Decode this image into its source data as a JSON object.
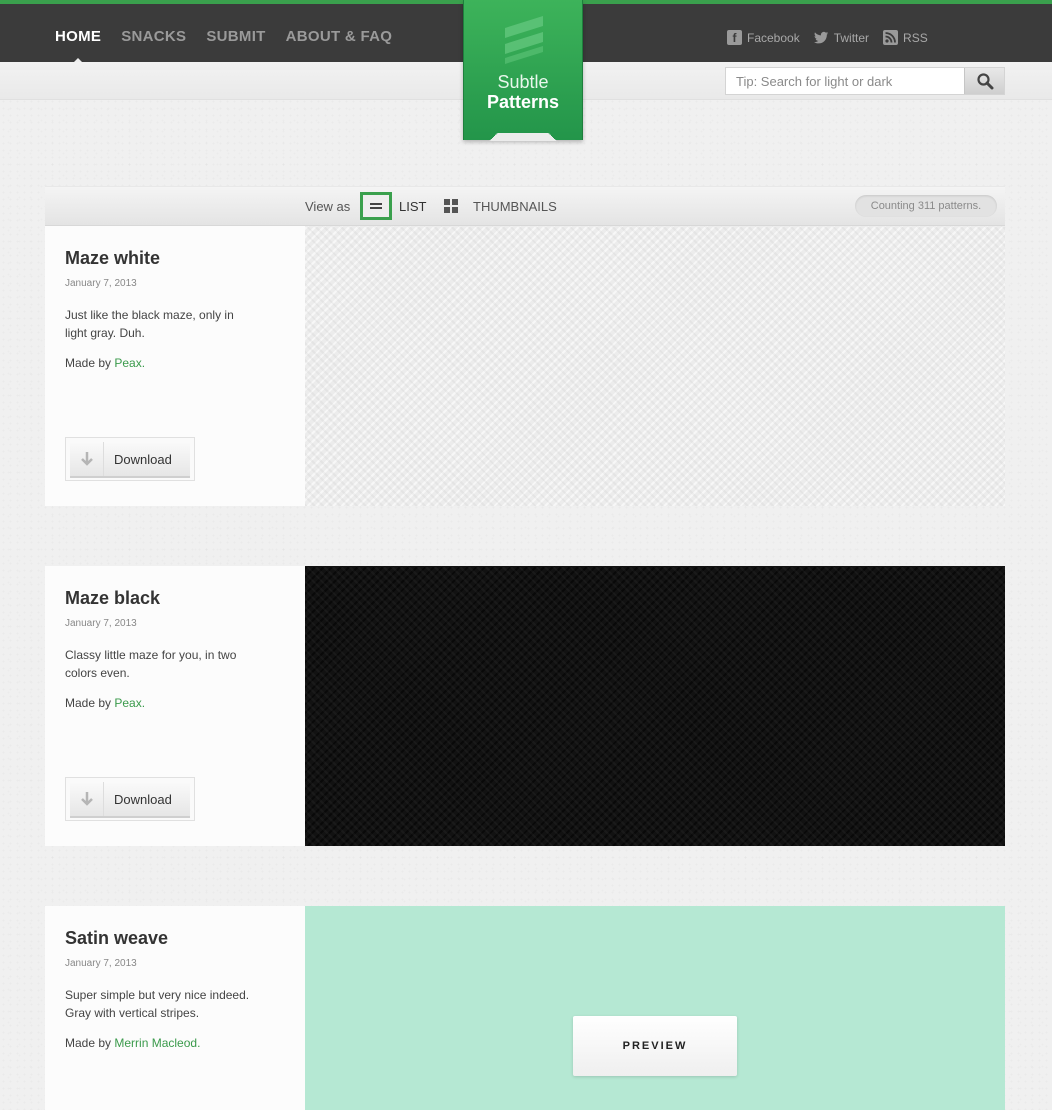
{
  "nav": {
    "items": [
      {
        "label": "HOME",
        "active": true
      },
      {
        "label": "SNACKS",
        "active": false
      },
      {
        "label": "SUBMIT",
        "active": false
      },
      {
        "label": "ABOUT & FAQ",
        "active": false
      }
    ]
  },
  "social": {
    "facebook": "Facebook",
    "twitter": "Twitter",
    "rss": "RSS"
  },
  "logo": {
    "line1": "Subtle",
    "line2": "Patterns"
  },
  "search": {
    "placeholder": "Tip: Search for light or dark"
  },
  "viewbar": {
    "view_as": "View as",
    "list_label": "LIST",
    "thumbnails_label": "THUMBNAILS",
    "counter": "Counting 311 patterns."
  },
  "patterns": [
    {
      "title": "Maze white",
      "date": "January 7, 2013",
      "description": "Just like the black maze, only in light gray. Duh.",
      "made_by": "Made by",
      "author": "Peax.",
      "download_label": "Download"
    },
    {
      "title": "Maze black",
      "date": "January 7, 2013",
      "description": "Classy little maze for you, in two colors even.",
      "made_by": "Made by",
      "author": "Peax.",
      "download_label": "Download"
    },
    {
      "title": "Satin weave",
      "date": "January 7, 2013",
      "description": "Super simple but very nice indeed. Gray with vertical stripes.",
      "made_by": "Made by",
      "author": "Merrin Macleod.",
      "preview_label": "PREVIEW"
    }
  ],
  "colors": {
    "accent": "#3aa04d",
    "topbar": "#3b3b3b",
    "satin_preview": "#b5e8d3",
    "maze_black_preview": "#121212",
    "maze_white_preview": "#ececec"
  }
}
